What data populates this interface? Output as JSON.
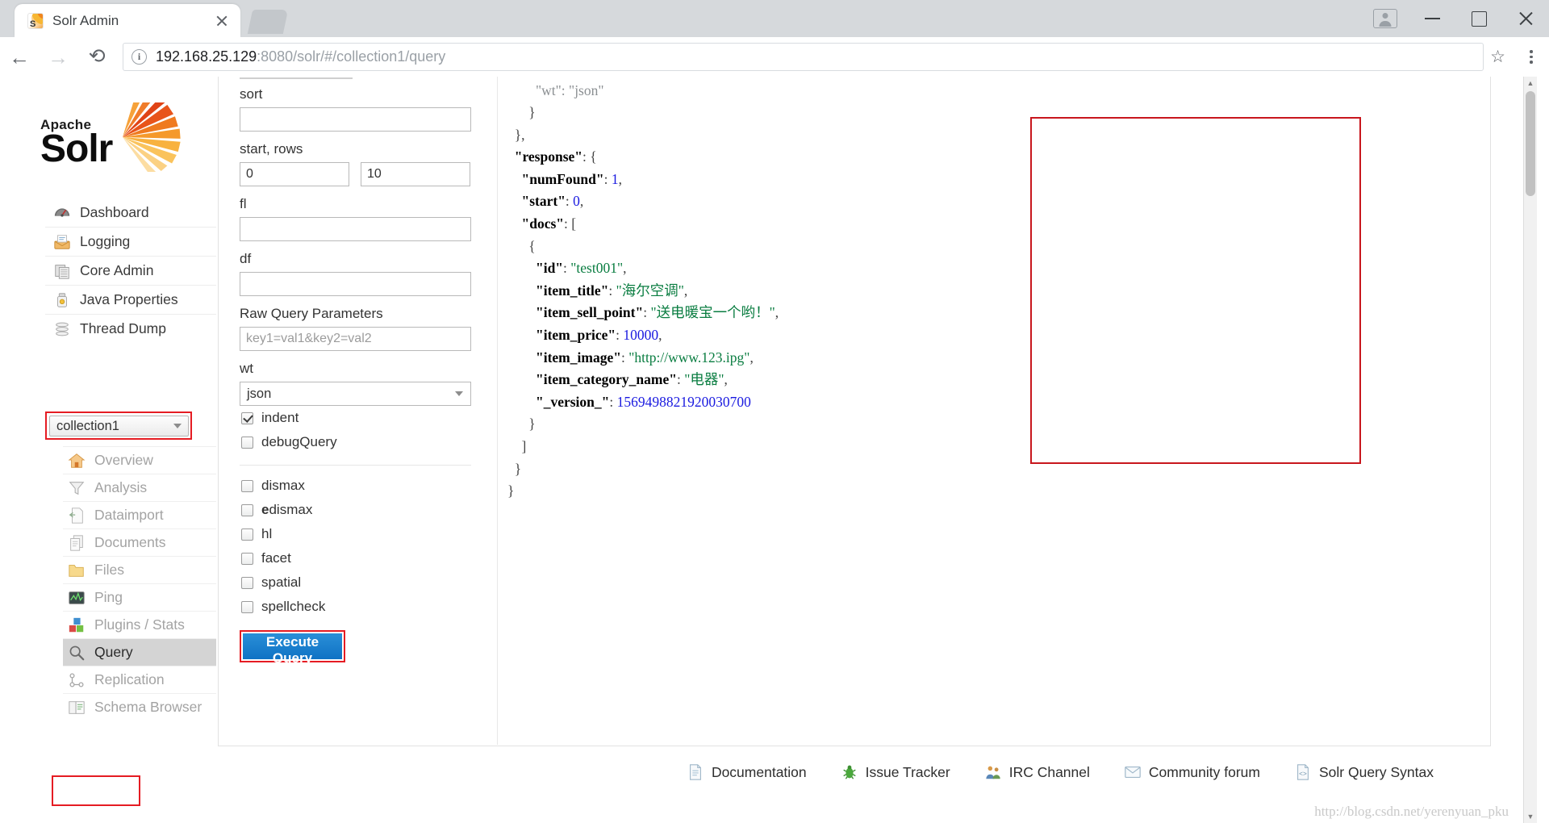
{
  "browser": {
    "tab_title": "Solr Admin",
    "favicon": "solr-favicon",
    "url_host": "192.168.25.129",
    "url_rest": ":8080/solr/#/collection1/query",
    "back_glyph": "←",
    "forward_glyph": "→",
    "reload_glyph": "⟳",
    "star_glyph": "☆",
    "info_glyph": "i"
  },
  "sidebar": {
    "logo_apache": "Apache",
    "logo_solr": "Solr",
    "global_items": [
      {
        "label": "Dashboard",
        "icon": "dashboard-icon"
      },
      {
        "label": "Logging",
        "icon": "logging-icon"
      },
      {
        "label": "Core Admin",
        "icon": "core-admin-icon"
      },
      {
        "label": "Java Properties",
        "icon": "java-properties-icon"
      },
      {
        "label": "Thread Dump",
        "icon": "thread-dump-icon"
      }
    ],
    "core_selector": {
      "value": "collection1",
      "highlight_color": "#e51c23"
    },
    "core_items": [
      {
        "label": "Overview",
        "icon": "overview-home-icon",
        "active": false
      },
      {
        "label": "Analysis",
        "icon": "analysis-funnel-icon",
        "active": false
      },
      {
        "label": "Dataimport",
        "icon": "dataimport-icon",
        "active": false
      },
      {
        "label": "Documents",
        "icon": "documents-icon",
        "active": false
      },
      {
        "label": "Files",
        "icon": "files-folder-icon",
        "active": false
      },
      {
        "label": "Ping",
        "icon": "ping-icon",
        "active": false
      },
      {
        "label": "Plugins / Stats",
        "icon": "plugins-stats-icon",
        "active": false
      },
      {
        "label": "Query",
        "icon": "query-magnifier-icon",
        "active": true
      },
      {
        "label": "Replication",
        "icon": "replication-icon",
        "active": false
      },
      {
        "label": "Schema Browser",
        "icon": "schema-browser-icon",
        "active": false
      }
    ]
  },
  "query_form": {
    "fields": [
      {
        "name": "sort",
        "label": "sort",
        "value": "",
        "placeholder": ""
      },
      {
        "name": "fl",
        "label": "fl",
        "value": "",
        "placeholder": ""
      },
      {
        "name": "df",
        "label": "df",
        "value": "",
        "placeholder": ""
      }
    ],
    "start_rows_label": "start, rows",
    "start_value": "0",
    "rows_value": "10",
    "raw_query_label": "Raw Query Parameters",
    "raw_query_placeholder": "key1=val1&key2=val2",
    "raw_query_value": "",
    "wt_label": "wt",
    "wt_value": "json",
    "checkboxes_primary": [
      {
        "label": "indent",
        "checked": true
      },
      {
        "label": "debugQuery",
        "checked": false
      }
    ],
    "checkboxes_secondary": [
      {
        "label": "dismax",
        "checked": false,
        "bold_prefix": ""
      },
      {
        "label": "edismax",
        "checked": false,
        "bold_prefix": "e"
      },
      {
        "label": "hl",
        "checked": false,
        "bold_prefix": ""
      },
      {
        "label": "facet",
        "checked": false,
        "bold_prefix": ""
      },
      {
        "label": "spatial",
        "checked": false,
        "bold_prefix": ""
      },
      {
        "label": "spellcheck",
        "checked": false,
        "bold_prefix": ""
      }
    ],
    "execute_label": "Execute Query",
    "execute_highlight_color": "#e51c23"
  },
  "result": {
    "highlight_color": "#c8161d",
    "lines": [
      {
        "indent": 4,
        "segments": [
          {
            "t": "\"wt\"",
            "c": "faded"
          },
          {
            "t": ": ",
            "c": "faded"
          },
          {
            "t": "\"json\"",
            "c": "faded"
          }
        ]
      },
      {
        "indent": 3,
        "segments": [
          {
            "t": "}",
            "c": "pun"
          }
        ]
      },
      {
        "indent": 1,
        "segments": [
          {
            "t": "},",
            "c": "pun"
          }
        ]
      },
      {
        "indent": 1,
        "segments": [
          {
            "t": "\"response\"",
            "c": "key"
          },
          {
            "t": ": {",
            "c": "pun"
          }
        ]
      },
      {
        "indent": 2,
        "segments": [
          {
            "t": "\"numFound\"",
            "c": "key"
          },
          {
            "t": ": ",
            "c": "pun"
          },
          {
            "t": "1",
            "c": "num"
          },
          {
            "t": ",",
            "c": "pun"
          }
        ]
      },
      {
        "indent": 2,
        "segments": [
          {
            "t": "\"start\"",
            "c": "key"
          },
          {
            "t": ": ",
            "c": "pun"
          },
          {
            "t": "0",
            "c": "num"
          },
          {
            "t": ",",
            "c": "pun"
          }
        ]
      },
      {
        "indent": 2,
        "segments": [
          {
            "t": "\"docs\"",
            "c": "key"
          },
          {
            "t": ": [",
            "c": "pun"
          }
        ]
      },
      {
        "indent": 3,
        "segments": [
          {
            "t": "{",
            "c": "pun"
          }
        ]
      },
      {
        "indent": 4,
        "segments": [
          {
            "t": "\"id\"",
            "c": "key"
          },
          {
            "t": ": ",
            "c": "pun"
          },
          {
            "t": "\"test001\"",
            "c": "str"
          },
          {
            "t": ",",
            "c": "pun"
          }
        ]
      },
      {
        "indent": 4,
        "segments": [
          {
            "t": "\"item_title\"",
            "c": "key"
          },
          {
            "t": ": ",
            "c": "pun"
          },
          {
            "t": "\"海尔空调\"",
            "c": "str"
          },
          {
            "t": ",",
            "c": "pun"
          }
        ]
      },
      {
        "indent": 4,
        "segments": [
          {
            "t": "\"item_sell_point\"",
            "c": "key"
          },
          {
            "t": ": ",
            "c": "pun"
          },
          {
            "t": "\"送电暖宝一个哟！\"",
            "c": "str"
          },
          {
            "t": ",",
            "c": "pun"
          }
        ]
      },
      {
        "indent": 4,
        "segments": [
          {
            "t": "\"item_price\"",
            "c": "key"
          },
          {
            "t": ": ",
            "c": "pun"
          },
          {
            "t": "10000",
            "c": "num"
          },
          {
            "t": ",",
            "c": "pun"
          }
        ]
      },
      {
        "indent": 4,
        "segments": [
          {
            "t": "\"item_image\"",
            "c": "key"
          },
          {
            "t": ": ",
            "c": "pun"
          },
          {
            "t": "\"http://www.123.ipg\"",
            "c": "str"
          },
          {
            "t": ",",
            "c": "pun"
          }
        ]
      },
      {
        "indent": 4,
        "segments": [
          {
            "t": "\"item_category_name\"",
            "c": "key"
          },
          {
            "t": ": ",
            "c": "pun"
          },
          {
            "t": "\"电器\"",
            "c": "str"
          },
          {
            "t": ",",
            "c": "pun"
          }
        ]
      },
      {
        "indent": 4,
        "segments": [
          {
            "t": "\"_version_\"",
            "c": "key"
          },
          {
            "t": ": ",
            "c": "pun"
          },
          {
            "t": "1569498821920030700",
            "c": "num"
          }
        ]
      },
      {
        "indent": 3,
        "segments": [
          {
            "t": "}",
            "c": "pun"
          }
        ]
      },
      {
        "indent": 2,
        "segments": [
          {
            "t": "]",
            "c": "pun"
          }
        ]
      },
      {
        "indent": 1,
        "segments": [
          {
            "t": "}",
            "c": "pun"
          }
        ]
      },
      {
        "indent": 0,
        "segments": [
          {
            "t": "}",
            "c": "pun"
          }
        ]
      }
    ]
  },
  "footer": {
    "links": [
      {
        "label": "Documentation",
        "icon": "documentation-page-icon"
      },
      {
        "label": "Issue Tracker",
        "icon": "issue-tracker-bug-icon"
      },
      {
        "label": "IRC Channel",
        "icon": "irc-channel-people-icon"
      },
      {
        "label": "Community forum",
        "icon": "community-forum-envelope-icon"
      },
      {
        "label": "Solr Query Syntax",
        "icon": "solr-query-syntax-icon"
      }
    ],
    "watermark": "http://blog.csdn.net/yerenyuan_pku"
  }
}
